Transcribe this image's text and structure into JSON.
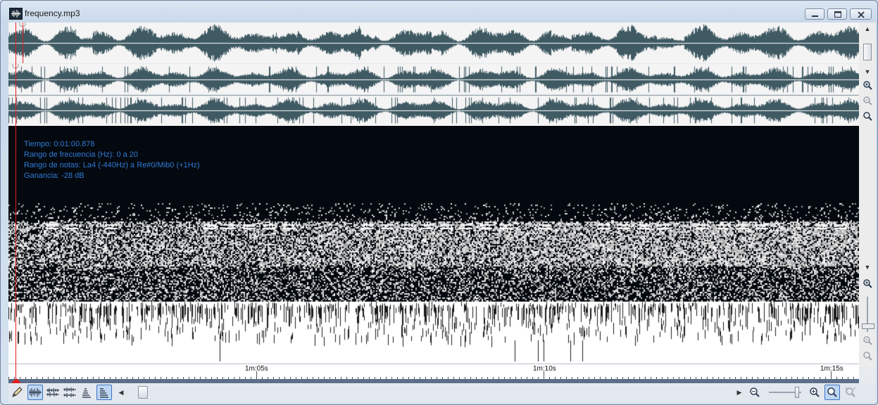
{
  "window": {
    "title": "frequency.mp3",
    "minimize_icon": "minimize-icon",
    "maximize_icon": "maximize-icon",
    "close_icon": "close-icon"
  },
  "info": {
    "time": "Tiempo: 0:01:00.878",
    "freq_range": "Rango de frecuencia (Hz): 0 a 20",
    "note_range": "Rango de notas: La4 (-440Hz) a Re#0/Mib0 (+1Hz)",
    "gain": "Ganancia: -28 dB"
  },
  "timeline": {
    "labels": [
      "1m:05s",
      "1m:10s",
      "1m:15s"
    ]
  },
  "colors": {
    "waveform": "#3f5a63",
    "playhead": "#e41c1c",
    "info_text": "#2f7ad6",
    "spectrogram_bg": "#04090f"
  },
  "toolbar": {
    "tools": [
      "pencil-icon",
      "waveform-view-icon",
      "stereo-view-icon",
      "split-view-icon",
      "spectral-view-icon",
      "spectrogram-view-icon"
    ],
    "zoom_controls": [
      "zoom-out-icon",
      "zoom-slider",
      "zoom-in-icon",
      "zoom-selection-icon",
      "zoom-fit-icon"
    ]
  }
}
